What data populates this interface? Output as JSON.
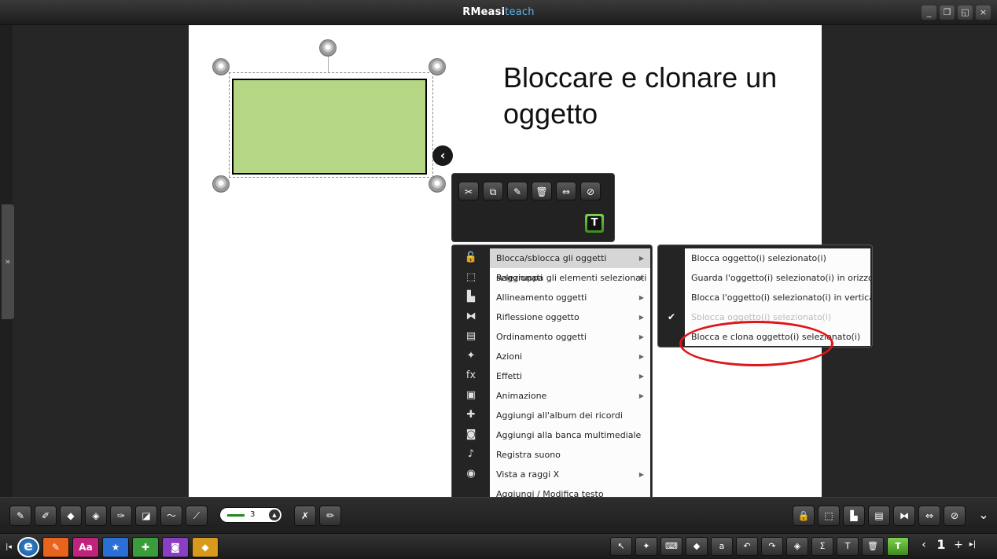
{
  "window": {
    "title_brand": "RMeasi",
    "title_accent": "teach",
    "minimize": "_",
    "restore": "❐",
    "fullscreen": "◱",
    "close": "×"
  },
  "left_panel": {
    "expand_glyph": "»"
  },
  "canvas": {
    "slide_title": "Bloccare e clonare un oggetto",
    "shape_color": "#b5d685",
    "collapse_glyph": "‹"
  },
  "tool_panel": {
    "buttons": [
      {
        "icon": "cut-icon",
        "glyph": "✂"
      },
      {
        "icon": "copy-icon",
        "glyph": "⧉"
      },
      {
        "icon": "paste-icon",
        "glyph": "✎"
      },
      {
        "icon": "delete-icon",
        "glyph": "🗑"
      },
      {
        "icon": "link-icon",
        "glyph": "⇔"
      },
      {
        "icon": "clone-icon",
        "glyph": "⊘"
      }
    ],
    "text_tool": "T"
  },
  "context_menu": {
    "items": [
      {
        "label": "Blocca/sblocca gli oggetti selezionati",
        "icon": "lock-icon",
        "glyph": "🔓",
        "submenu": true,
        "active": true
      },
      {
        "label": "Raggruppa gli elementi selezionati",
        "icon": "group-icon",
        "glyph": "⬚",
        "submenu": true
      },
      {
        "label": "Allineamento oggetti",
        "icon": "align-icon",
        "glyph": "▙",
        "submenu": true
      },
      {
        "label": "Riflessione oggetto",
        "icon": "mirror-icon",
        "glyph": "⧓",
        "submenu": true
      },
      {
        "label": "Ordinamento oggetti",
        "icon": "order-icon",
        "glyph": "▤",
        "submenu": true
      },
      {
        "label": "Azioni",
        "icon": "actions-icon",
        "glyph": "✦",
        "submenu": true
      },
      {
        "label": "Effetti",
        "icon": "effects-icon",
        "glyph": "fx",
        "submenu": true
      },
      {
        "label": "Animazione",
        "icon": "animation-icon",
        "glyph": "▣",
        "submenu": true
      },
      {
        "label": "Aggiungi all'album dei ricordi",
        "icon": "album-icon",
        "glyph": "✚",
        "submenu": false
      },
      {
        "label": "Aggiungi alla banca multimediale",
        "icon": "camera-icon",
        "glyph": "◙",
        "submenu": false
      },
      {
        "label": "Registra suono",
        "icon": "sound-icon",
        "glyph": "♪",
        "submenu": false
      },
      {
        "label": "Vista a raggi X",
        "icon": "xray-icon",
        "glyph": "◉",
        "submenu": true
      },
      {
        "label": "Aggiungi / Modifica testo",
        "icon": "",
        "glyph": "",
        "submenu": false
      }
    ],
    "arrow": "▶"
  },
  "submenu": {
    "items": [
      {
        "label": "Blocca oggetto(i) selezionato(i)",
        "disabled": false
      },
      {
        "label": "Guarda l'oggetto(i) selezionato(i) in orizzontale",
        "disabled": false
      },
      {
        "label": "Blocca l'oggetto(i) selezionato(i) in verticale",
        "disabled": false
      },
      {
        "label": "Sblocca oggetto(i) selezionato(i)",
        "disabled": true
      },
      {
        "label": "Blocca e clona oggetto(i) selezionato(i)",
        "disabled": false
      }
    ],
    "check": "✔",
    "highlight_color": "#e0151b"
  },
  "toolbar_top": {
    "pen_tools": [
      {
        "icon": "pen-icon",
        "glyph": "✎"
      },
      {
        "icon": "smart-pen-icon",
        "glyph": "✐"
      },
      {
        "icon": "highlighter-icon",
        "glyph": "◆"
      },
      {
        "icon": "fill-icon",
        "glyph": "◈"
      },
      {
        "icon": "brush-icon",
        "glyph": "✑"
      },
      {
        "icon": "shape-icon",
        "glyph": "◪"
      },
      {
        "icon": "freehand-line-icon",
        "glyph": "〜"
      },
      {
        "icon": "line-icon",
        "glyph": "⟋"
      }
    ],
    "line_width": "3",
    "extra_tools": [
      {
        "icon": "magic-wand-icon",
        "glyph": "✗"
      },
      {
        "icon": "ruler-icon",
        "glyph": "✏"
      }
    ],
    "right_tools": [
      {
        "icon": "lock-icon",
        "glyph": "🔒"
      },
      {
        "icon": "group-icon",
        "glyph": "⬚"
      },
      {
        "icon": "align-icon",
        "glyph": "▙"
      },
      {
        "icon": "order-icon",
        "glyph": "▤"
      },
      {
        "icon": "mirror-icon",
        "glyph": "⧓"
      },
      {
        "icon": "link-icon",
        "glyph": "⇔"
      },
      {
        "icon": "clone-icon",
        "glyph": "⊘"
      }
    ],
    "more_glyph": "⌄"
  },
  "toolbar_bottom": {
    "first_glyph": "|◂",
    "easi_logo": "e",
    "apps": [
      {
        "icon": "pen-app-icon",
        "glyph": "✎",
        "bg": "#e8631c"
      },
      {
        "icon": "text-app-icon",
        "glyph": "Aa",
        "bg": "#c0237b"
      },
      {
        "icon": "stars-app-icon",
        "glyph": "★",
        "bg": "#2a6fd6"
      },
      {
        "icon": "plug-app-icon",
        "glyph": "✚",
        "bg": "#3a9c3a"
      },
      {
        "icon": "camera-app-icon",
        "glyph": "◙",
        "bg": "#8a3fc2"
      },
      {
        "icon": "paint-app-icon",
        "glyph": "◆",
        "bg": "#d89a1c"
      }
    ],
    "right_tools": [
      {
        "icon": "select-icon",
        "glyph": "↖"
      },
      {
        "icon": "magic-select-icon",
        "glyph": "✦"
      },
      {
        "icon": "keyboard-icon",
        "glyph": "⌨"
      },
      {
        "icon": "eraser-icon",
        "glyph": "◆"
      },
      {
        "icon": "lock-text-icon",
        "glyph": "a"
      },
      {
        "icon": "undo-icon",
        "glyph": "↶"
      },
      {
        "icon": "redo-icon",
        "glyph": "↷"
      },
      {
        "icon": "fill-icon",
        "glyph": "◈"
      },
      {
        "icon": "sigma-icon",
        "glyph": "Σ"
      },
      {
        "icon": "text-cursor-icon",
        "glyph": "T"
      },
      {
        "icon": "delete-icon",
        "glyph": "🗑"
      },
      {
        "icon": "text-box-icon",
        "glyph": "T"
      }
    ],
    "prev_glyph": "‹",
    "page_number": "1",
    "add_page_glyph": "+",
    "last_glyph": "▸|"
  }
}
